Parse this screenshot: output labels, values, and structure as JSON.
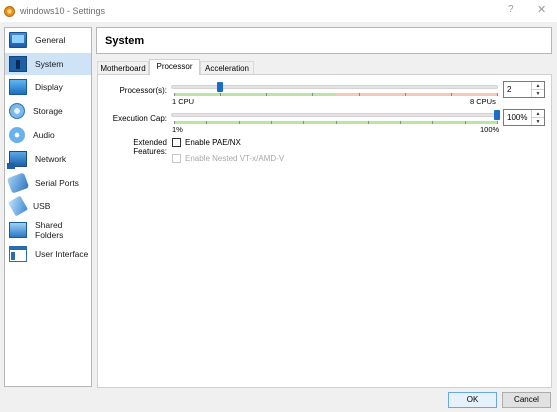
{
  "window": {
    "title": "windows10 - Settings",
    "help_label": "?",
    "close_label": "✕"
  },
  "sidebar": {
    "items": [
      {
        "label": "General",
        "icon": "general-icon",
        "active": false
      },
      {
        "label": "System",
        "icon": "motherboard-icon",
        "active": true
      },
      {
        "label": "Display",
        "icon": "display-icon",
        "active": false
      },
      {
        "label": "Storage",
        "icon": "storage-icon",
        "active": false
      },
      {
        "label": "Audio",
        "icon": "audio-icon",
        "active": false
      },
      {
        "label": "Network",
        "icon": "network-icon",
        "active": false
      },
      {
        "label": "Serial Ports",
        "icon": "serial-port-icon",
        "active": false
      },
      {
        "label": "USB",
        "icon": "usb-icon",
        "active": false
      },
      {
        "label": "Shared Folders",
        "icon": "shared-folder-icon",
        "active": false
      },
      {
        "label": "User Interface",
        "icon": "user-interface-icon",
        "active": false
      }
    ]
  },
  "header": {
    "title": "System"
  },
  "tabs": [
    {
      "label": "Motherboard",
      "active": false
    },
    {
      "label": "Processor",
      "active": true
    },
    {
      "label": "Acceleration",
      "active": false
    }
  ],
  "processor": {
    "processors_label": "Processor(s):",
    "processors_value": "2",
    "processors_min_label": "1 CPU",
    "processors_max_label": "8 CPUs",
    "processors_min": 1,
    "processors_max": 8,
    "processors_current": 2,
    "cap_label": "Execution Cap:",
    "cap_value": "100%",
    "cap_min_label": "1%",
    "cap_max_label": "100%",
    "cap_min": 1,
    "cap_max": 100,
    "cap_current": 100,
    "extended_label": "Extended Features:",
    "pae_label": "Enable PAE/NX",
    "pae_checked": false,
    "nested_label": "Enable Nested VT-x/AMD-V",
    "nested_checked": false,
    "nested_enabled": false
  },
  "colors": {
    "safe_zone": "#b9e6a7",
    "warn_zone": "#f6c9b6",
    "knob": "#1b6cc8",
    "active_item_bg": "#cfe3f7"
  },
  "buttons": {
    "ok_label": "OK",
    "cancel_label": "Cancel"
  }
}
